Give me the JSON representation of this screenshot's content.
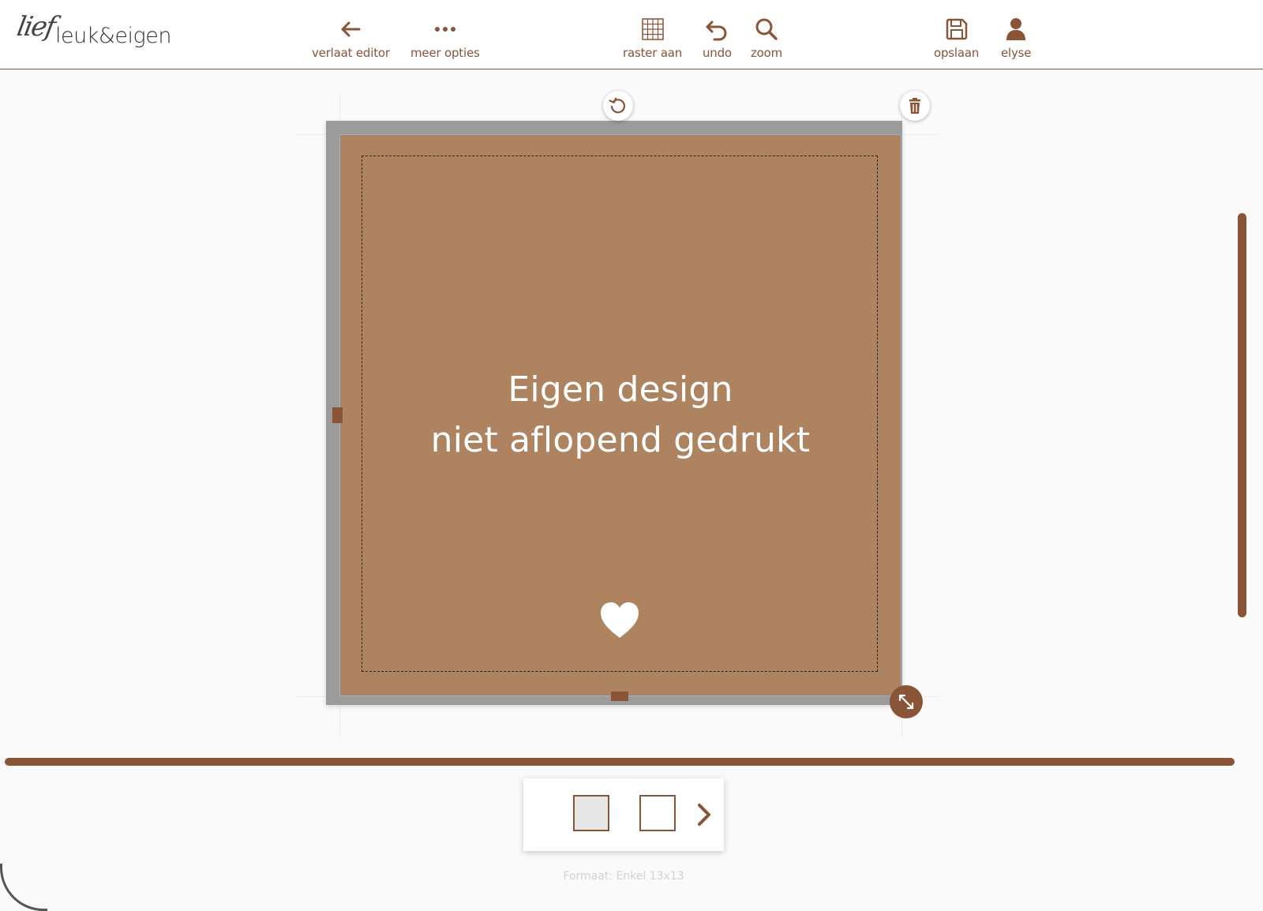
{
  "logo": {
    "script": "lief",
    "text": "leuk&eigen"
  },
  "toolbar": {
    "back_label": "verlaat editor",
    "more_label": "meer opties",
    "grid_label": "raster aan",
    "undo_label": "undo",
    "zoom_label": "zoom",
    "save_label": "opslaan",
    "user_label": "elyse"
  },
  "design": {
    "line1": "Eigen design",
    "line2": "niet aflopend gedrukt"
  },
  "footer": {
    "format": "Formaat: Enkel 13x13"
  },
  "colors": {
    "accent": "#8a5436",
    "page_fill": "#ae8360",
    "frame": "#9b9b9b",
    "background": "#fafafa"
  },
  "icons": {
    "back": "arrow-left-icon",
    "more": "dots-icon",
    "grid": "grid-icon",
    "undo": "undo-icon",
    "zoom": "search-icon",
    "save": "floppy-icon",
    "user": "user-icon",
    "rotate": "rotate-icon",
    "delete": "trash-icon",
    "resize": "resize-icon",
    "heart": "heart-icon",
    "next": "chevron-right-icon"
  }
}
